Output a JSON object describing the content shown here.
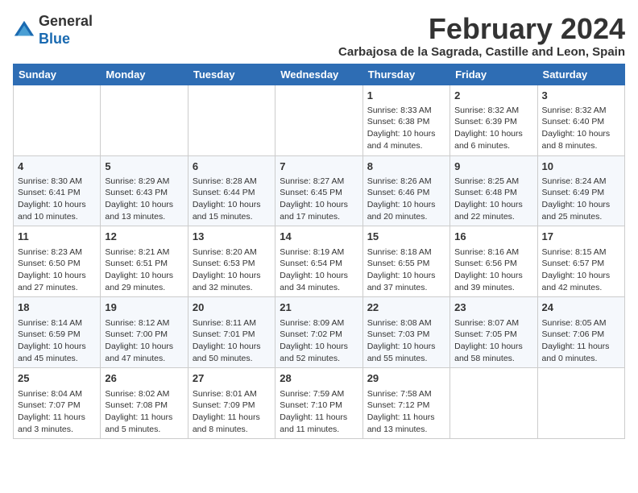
{
  "header": {
    "logo_general": "General",
    "logo_blue": "Blue",
    "month_year": "February 2024",
    "location": "Carbajosa de la Sagrada, Castille and Leon, Spain"
  },
  "weekdays": [
    "Sunday",
    "Monday",
    "Tuesday",
    "Wednesday",
    "Thursday",
    "Friday",
    "Saturday"
  ],
  "weeks": [
    [
      {
        "day": "",
        "sunrise": "",
        "sunset": "",
        "daylight": "",
        "empty": true
      },
      {
        "day": "",
        "sunrise": "",
        "sunset": "",
        "daylight": "",
        "empty": true
      },
      {
        "day": "",
        "sunrise": "",
        "sunset": "",
        "daylight": "",
        "empty": true
      },
      {
        "day": "",
        "sunrise": "",
        "sunset": "",
        "daylight": "",
        "empty": true
      },
      {
        "day": "1",
        "sunrise": "Sunrise: 8:33 AM",
        "sunset": "Sunset: 6:38 PM",
        "daylight": "Daylight: 10 hours and 4 minutes."
      },
      {
        "day": "2",
        "sunrise": "Sunrise: 8:32 AM",
        "sunset": "Sunset: 6:39 PM",
        "daylight": "Daylight: 10 hours and 6 minutes."
      },
      {
        "day": "3",
        "sunrise": "Sunrise: 8:32 AM",
        "sunset": "Sunset: 6:40 PM",
        "daylight": "Daylight: 10 hours and 8 minutes."
      }
    ],
    [
      {
        "day": "4",
        "sunrise": "Sunrise: 8:30 AM",
        "sunset": "Sunset: 6:41 PM",
        "daylight": "Daylight: 10 hours and 10 minutes."
      },
      {
        "day": "5",
        "sunrise": "Sunrise: 8:29 AM",
        "sunset": "Sunset: 6:43 PM",
        "daylight": "Daylight: 10 hours and 13 minutes."
      },
      {
        "day": "6",
        "sunrise": "Sunrise: 8:28 AM",
        "sunset": "Sunset: 6:44 PM",
        "daylight": "Daylight: 10 hours and 15 minutes."
      },
      {
        "day": "7",
        "sunrise": "Sunrise: 8:27 AM",
        "sunset": "Sunset: 6:45 PM",
        "daylight": "Daylight: 10 hours and 17 minutes."
      },
      {
        "day": "8",
        "sunrise": "Sunrise: 8:26 AM",
        "sunset": "Sunset: 6:46 PM",
        "daylight": "Daylight: 10 hours and 20 minutes."
      },
      {
        "day": "9",
        "sunrise": "Sunrise: 8:25 AM",
        "sunset": "Sunset: 6:48 PM",
        "daylight": "Daylight: 10 hours and 22 minutes."
      },
      {
        "day": "10",
        "sunrise": "Sunrise: 8:24 AM",
        "sunset": "Sunset: 6:49 PM",
        "daylight": "Daylight: 10 hours and 25 minutes."
      }
    ],
    [
      {
        "day": "11",
        "sunrise": "Sunrise: 8:23 AM",
        "sunset": "Sunset: 6:50 PM",
        "daylight": "Daylight: 10 hours and 27 minutes."
      },
      {
        "day": "12",
        "sunrise": "Sunrise: 8:21 AM",
        "sunset": "Sunset: 6:51 PM",
        "daylight": "Daylight: 10 hours and 29 minutes."
      },
      {
        "day": "13",
        "sunrise": "Sunrise: 8:20 AM",
        "sunset": "Sunset: 6:53 PM",
        "daylight": "Daylight: 10 hours and 32 minutes."
      },
      {
        "day": "14",
        "sunrise": "Sunrise: 8:19 AM",
        "sunset": "Sunset: 6:54 PM",
        "daylight": "Daylight: 10 hours and 34 minutes."
      },
      {
        "day": "15",
        "sunrise": "Sunrise: 8:18 AM",
        "sunset": "Sunset: 6:55 PM",
        "daylight": "Daylight: 10 hours and 37 minutes."
      },
      {
        "day": "16",
        "sunrise": "Sunrise: 8:16 AM",
        "sunset": "Sunset: 6:56 PM",
        "daylight": "Daylight: 10 hours and 39 minutes."
      },
      {
        "day": "17",
        "sunrise": "Sunrise: 8:15 AM",
        "sunset": "Sunset: 6:57 PM",
        "daylight": "Daylight: 10 hours and 42 minutes."
      }
    ],
    [
      {
        "day": "18",
        "sunrise": "Sunrise: 8:14 AM",
        "sunset": "Sunset: 6:59 PM",
        "daylight": "Daylight: 10 hours and 45 minutes."
      },
      {
        "day": "19",
        "sunrise": "Sunrise: 8:12 AM",
        "sunset": "Sunset: 7:00 PM",
        "daylight": "Daylight: 10 hours and 47 minutes."
      },
      {
        "day": "20",
        "sunrise": "Sunrise: 8:11 AM",
        "sunset": "Sunset: 7:01 PM",
        "daylight": "Daylight: 10 hours and 50 minutes."
      },
      {
        "day": "21",
        "sunrise": "Sunrise: 8:09 AM",
        "sunset": "Sunset: 7:02 PM",
        "daylight": "Daylight: 10 hours and 52 minutes."
      },
      {
        "day": "22",
        "sunrise": "Sunrise: 8:08 AM",
        "sunset": "Sunset: 7:03 PM",
        "daylight": "Daylight: 10 hours and 55 minutes."
      },
      {
        "day": "23",
        "sunrise": "Sunrise: 8:07 AM",
        "sunset": "Sunset: 7:05 PM",
        "daylight": "Daylight: 10 hours and 58 minutes."
      },
      {
        "day": "24",
        "sunrise": "Sunrise: 8:05 AM",
        "sunset": "Sunset: 7:06 PM",
        "daylight": "Daylight: 11 hours and 0 minutes."
      }
    ],
    [
      {
        "day": "25",
        "sunrise": "Sunrise: 8:04 AM",
        "sunset": "Sunset: 7:07 PM",
        "daylight": "Daylight: 11 hours and 3 minutes."
      },
      {
        "day": "26",
        "sunrise": "Sunrise: 8:02 AM",
        "sunset": "Sunset: 7:08 PM",
        "daylight": "Daylight: 11 hours and 5 minutes."
      },
      {
        "day": "27",
        "sunrise": "Sunrise: 8:01 AM",
        "sunset": "Sunset: 7:09 PM",
        "daylight": "Daylight: 11 hours and 8 minutes."
      },
      {
        "day": "28",
        "sunrise": "Sunrise: 7:59 AM",
        "sunset": "Sunset: 7:10 PM",
        "daylight": "Daylight: 11 hours and 11 minutes."
      },
      {
        "day": "29",
        "sunrise": "Sunrise: 7:58 AM",
        "sunset": "Sunset: 7:12 PM",
        "daylight": "Daylight: 11 hours and 13 minutes."
      },
      {
        "day": "",
        "sunrise": "",
        "sunset": "",
        "daylight": "",
        "empty": true
      },
      {
        "day": "",
        "sunrise": "",
        "sunset": "",
        "daylight": "",
        "empty": true
      }
    ]
  ]
}
